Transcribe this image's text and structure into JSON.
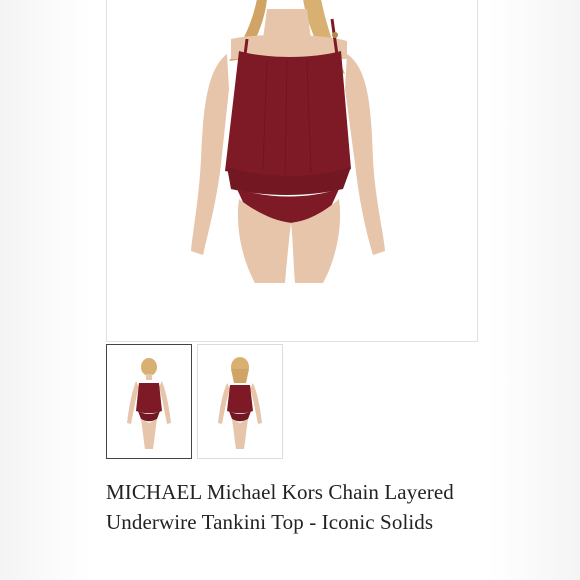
{
  "product": {
    "title": "MICHAEL Michael Kors Chain Layered Underwire Tankini Top - Iconic Solids"
  },
  "gallery": {
    "selected_index": 0,
    "thumbnails": [
      {
        "view": "front"
      },
      {
        "view": "back"
      }
    ]
  },
  "colors": {
    "swimsuit": "#7e1a26",
    "skin": "#e6c5ab",
    "hair": "#d8b072",
    "frame_border": "#e2e2e2",
    "selected_border": "#444444",
    "text": "#222222"
  }
}
